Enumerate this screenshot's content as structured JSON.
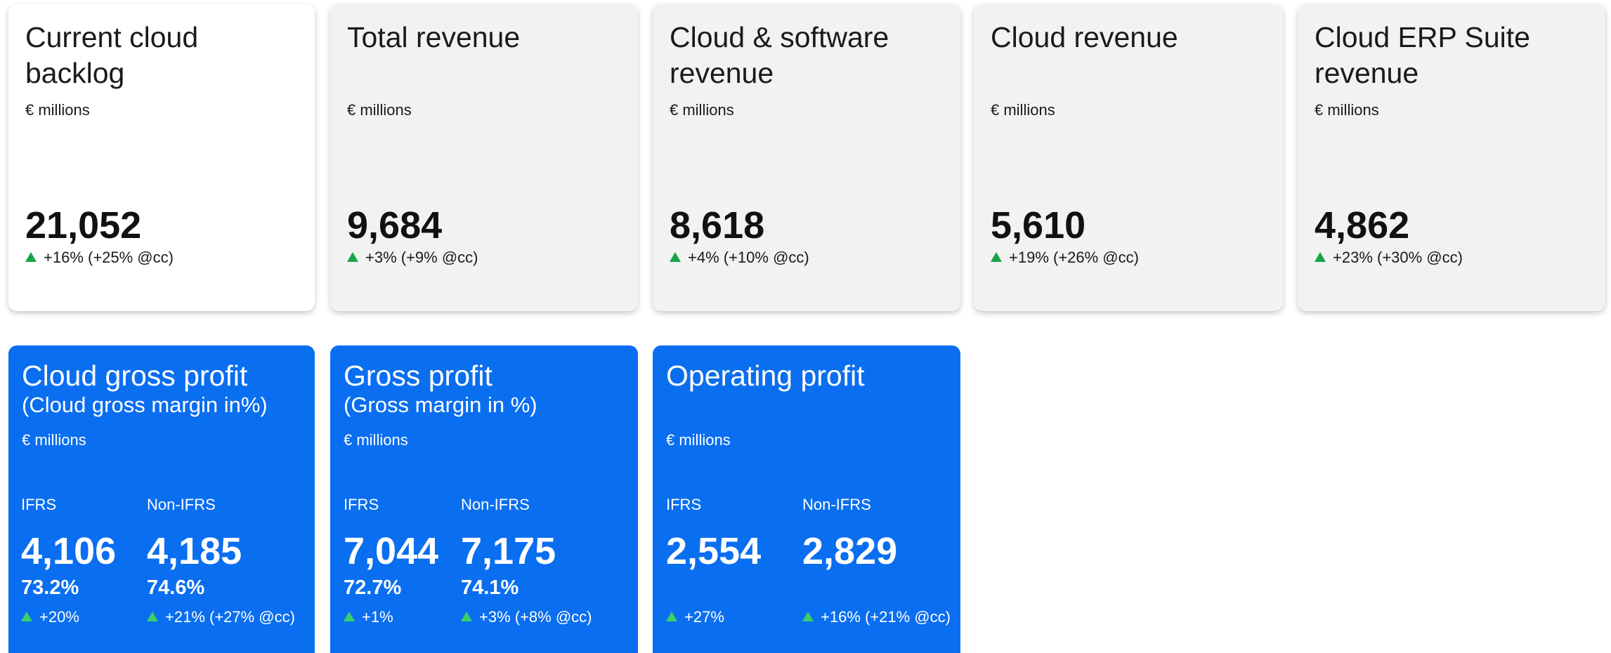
{
  "top_cards": [
    {
      "title": "Current cloud backlog",
      "unit": "€ millions",
      "value": "21,052",
      "change": "+16% (+25% @cc)"
    },
    {
      "title": "Total revenue",
      "unit": "€ millions",
      "value": "9,684",
      "change": "+3% (+9% @cc)"
    },
    {
      "title": "Cloud & software revenue",
      "unit": "€ millions",
      "value": "8,618",
      "change": "+4% (+10% @cc)"
    },
    {
      "title": "Cloud revenue",
      "unit": "€ millions",
      "value": "5,610",
      "change": "+19% (+26% @cc)"
    },
    {
      "title": "Cloud ERP Suite revenue",
      "unit": "€ millions",
      "value": "4,862",
      "change": "+23% (+30% @cc)"
    }
  ],
  "profit_cards": [
    {
      "title": "Cloud gross profit",
      "subtitle": "(Cloud gross margin in%)",
      "unit": "€ millions",
      "ifrs": {
        "label": "IFRS",
        "value": "4,106",
        "margin": "73.2%",
        "change": "+20%"
      },
      "non_ifrs": {
        "label": "Non-IFRS",
        "value": "4,185",
        "margin": "74.6%",
        "change": "+21% (+27% @cc)"
      }
    },
    {
      "title": "Gross profit",
      "subtitle": "(Gross margin in %)",
      "unit": "€ millions",
      "ifrs": {
        "label": "IFRS",
        "value": "7,044",
        "margin": "72.7%",
        "change": "+1%"
      },
      "non_ifrs": {
        "label": "Non-IFRS",
        "value": "7,175",
        "margin": "74.1%",
        "change": "+3% (+8% @cc)"
      }
    },
    {
      "title": "Operating profit",
      "subtitle": "",
      "unit": "€ millions",
      "ifrs": {
        "label": "IFRS",
        "value": "2,554",
        "margin": "",
        "change": "+27%"
      },
      "non_ifrs": {
        "label": "Non-IFRS",
        "value": "2,829",
        "margin": "",
        "change": "+16% (+21% @cc)"
      }
    }
  ],
  "colors": {
    "accent_blue": "#0a6ef0",
    "card_grey": "#f2f2f2",
    "up_green": "#1aa34a"
  },
  "icons": {
    "change_up": "triangle-up-icon"
  }
}
